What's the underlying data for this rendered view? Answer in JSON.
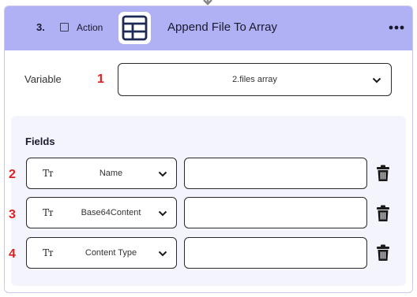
{
  "header": {
    "step_number": "3.",
    "action_label": "Action",
    "title": "Append File To Array",
    "icon": "table-icon",
    "more_icon": "more-horizontal-icon"
  },
  "variable": {
    "label": "Variable",
    "annotation": "1",
    "selected": "2.files array"
  },
  "fields": {
    "title": "Fields",
    "rows": [
      {
        "annotation": "2",
        "type_icon": "text-type-icon",
        "name": "Name",
        "value": ""
      },
      {
        "annotation": "3",
        "type_icon": "text-type-icon",
        "name": "Base64Content",
        "value": ""
      },
      {
        "annotation": "4",
        "type_icon": "text-type-icon",
        "name": "Content Type",
        "value": ""
      }
    ]
  },
  "colors": {
    "header_bg": "#b0b0f5",
    "annotation_red": "#e02020",
    "fields_bg": "#f4f4fc"
  }
}
